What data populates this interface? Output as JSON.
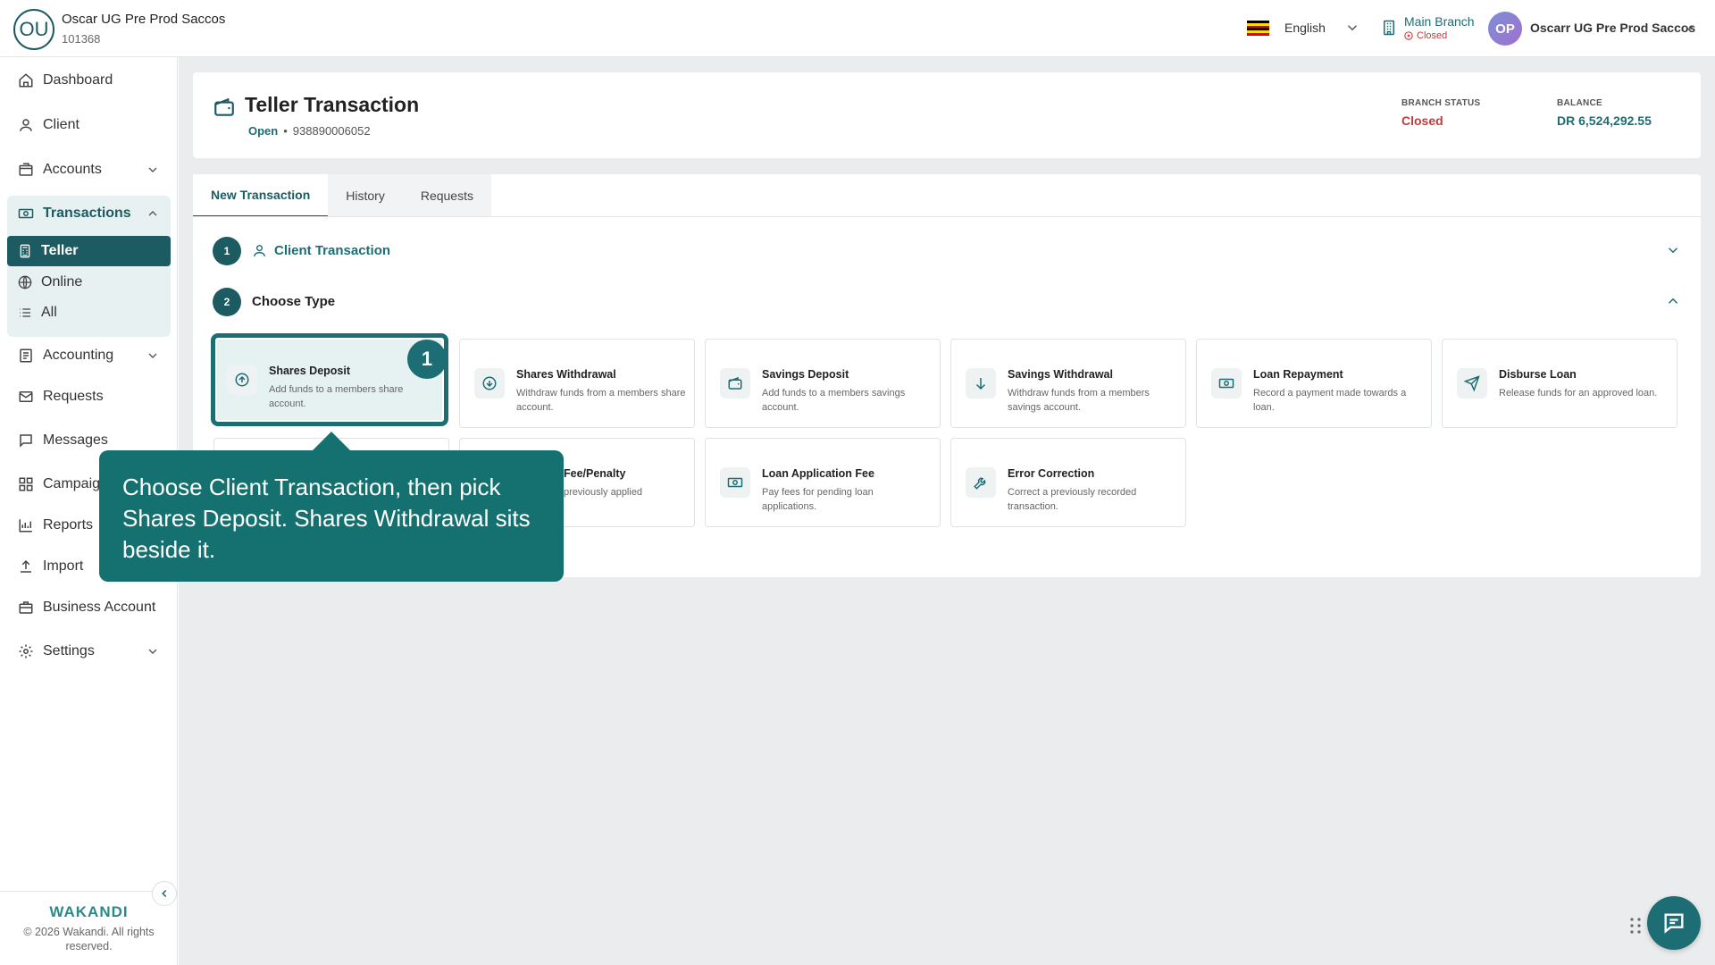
{
  "header": {
    "org_initials": "OU",
    "org_name": "Oscar UG Pre Prod Saccos",
    "org_id": "101368",
    "language": "English",
    "branch_name": "Main Branch",
    "branch_status": "Closed",
    "user_initials": "OP",
    "user_name": "Oscarr UG Pre Prod Saccos"
  },
  "sidebar": {
    "items": [
      {
        "label": "Dashboard",
        "icon": "home-icon"
      },
      {
        "label": "Client",
        "icon": "user-icon"
      },
      {
        "label": "Accounts",
        "icon": "accounts-icon"
      },
      {
        "label": "Transactions",
        "icon": "money-icon"
      },
      {
        "label": "Accounting",
        "icon": "ledger-icon"
      },
      {
        "label": "Requests",
        "icon": "mail-icon"
      },
      {
        "label": "Messages",
        "icon": "chat-icon"
      },
      {
        "label": "Campaigns",
        "icon": "grid-icon"
      },
      {
        "label": "Reports",
        "icon": "bar-chart-icon"
      },
      {
        "label": "Import",
        "icon": "upload-icon"
      },
      {
        "label": "Business Account",
        "icon": "briefcase-icon"
      },
      {
        "label": "Settings",
        "icon": "gear-icon"
      }
    ],
    "transactions_sub": [
      {
        "label": "Teller",
        "active": true
      },
      {
        "label": "Online",
        "active": false
      },
      {
        "label": "All",
        "active": false
      }
    ],
    "brand": "WAKANDI",
    "copyright": "© 2026 Wakandi. All rights reserved."
  },
  "page": {
    "title": "Teller Transaction",
    "status": "Open",
    "separator": "•",
    "account_number": "938890006052",
    "branch_status_label": "BRANCH STATUS",
    "branch_status_value": "Closed",
    "balance_label": "BALANCE",
    "balance_value": "DR 6,524,292.55"
  },
  "tabs": [
    "New Transaction",
    "History",
    "Requests"
  ],
  "steps": [
    {
      "number": "1",
      "label": "Client Transaction"
    },
    {
      "number": "2",
      "label": "Choose Type"
    }
  ],
  "transaction_types": [
    {
      "title": "Shares Deposit",
      "desc": "Add funds to a members share account.",
      "icon": "arrow-up-circle-icon"
    },
    {
      "title": "Shares Withdrawal",
      "desc": "Withdraw funds from a members share account.",
      "icon": "arrow-down-circle-icon"
    },
    {
      "title": "Savings Deposit",
      "desc": "Add funds to a members savings account.",
      "icon": "wallet-icon"
    },
    {
      "title": "Savings Withdrawal",
      "desc": "Withdraw funds from a members savings account.",
      "icon": "arrow-down-icon"
    },
    {
      "title": "Loan Repayment",
      "desc": "Record a payment made towards a loan.",
      "icon": "banknote-icon"
    },
    {
      "title": "Disburse Loan",
      "desc": "Release funds for an approved loan.",
      "icon": "send-icon"
    },
    {
      "title": "Fee/Penalty",
      "desc": "previously applied",
      "icon": "receipt-icon"
    },
    {
      "title": "Loan Application Fee",
      "desc": "Pay fees for pending loan applications.",
      "icon": "banknote-icon"
    },
    {
      "title": "Error Correction",
      "desc": "Correct a previously recorded transaction.",
      "icon": "wrench-icon"
    }
  ],
  "guide": {
    "badge": "1",
    "text": "Choose Client Transaction, then pick Shares Deposit. Shares Withdrawal sits beside it."
  },
  "colors": {
    "primary": "#1c5b62",
    "accent": "#1c6d74",
    "danger": "#c23b3b",
    "callout": "#15716f"
  }
}
